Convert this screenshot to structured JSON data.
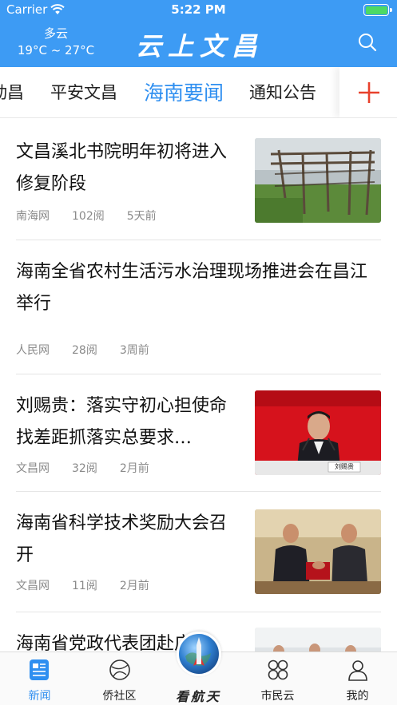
{
  "status_bar": {
    "carrier": "Carrier",
    "time": "5:22 PM"
  },
  "header": {
    "weather": {
      "condition": "多云",
      "temperature": "19°C ~ 27°C"
    },
    "title": "云上文昌",
    "search_icon": "search-icon"
  },
  "tabs": {
    "items": [
      {
        "label": "动昌"
      },
      {
        "label": "平安文昌"
      },
      {
        "label": "海南要闻"
      },
      {
        "label": "通知公告"
      }
    ],
    "active": "海南要闻",
    "add_icon": "plus-icon",
    "accent_color": "#2f8ff0",
    "add_color": "#e8412c"
  },
  "news": [
    {
      "title": "文昌溪北书院明年初将进入修复阶段",
      "source": "南海网",
      "reads": "102阅",
      "time": "5天前",
      "has_image": true,
      "image": "old-wooden-building-photo"
    },
    {
      "title": "海南全省农村生活污水治理现场推进会在昌江举行",
      "source": "人民网",
      "reads": "28阅",
      "time": "3周前",
      "has_image": false
    },
    {
      "title": "刘赐贵：落实守初心担使命找差距抓落实总要求…",
      "source": "文昌网",
      "reads": "32阅",
      "time": "2月前",
      "has_image": true,
      "image": "speaker-at-podium-photo",
      "nameplate": "刘赐贵"
    },
    {
      "title": "海南省科学技术奖励大会召开",
      "source": "文昌网",
      "reads": "11阅",
      "time": "2月前",
      "has_image": true,
      "image": "award-handshake-photo"
    },
    {
      "title": "海南省党政代表团赴广东",
      "has_image": true,
      "image": "delegation-photo"
    }
  ],
  "tabbar": {
    "items": [
      {
        "label": "新闻",
        "icon": "news-icon",
        "active": true
      },
      {
        "label": "侨社区",
        "icon": "community-icon",
        "active": false
      },
      {
        "label": "看航天",
        "icon": "globe-rocket-icon",
        "active": false
      },
      {
        "label": "市民云",
        "icon": "grid-icon",
        "active": false
      },
      {
        "label": "我的",
        "icon": "profile-icon",
        "active": false
      }
    ]
  },
  "colors": {
    "header_bg": "#3d9bf4",
    "active_blue": "#2f8ff0",
    "meta_gray": "#8a8a8a"
  }
}
